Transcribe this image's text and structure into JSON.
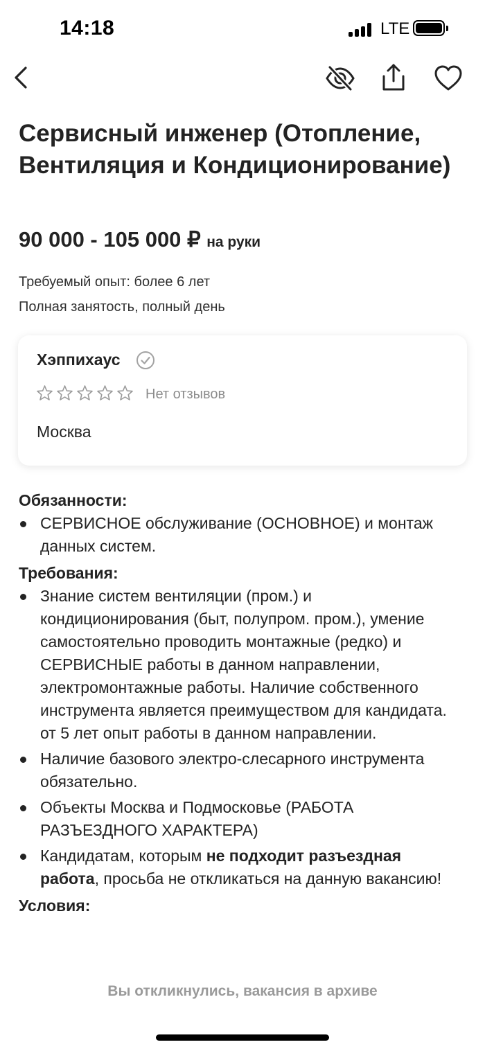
{
  "status_bar": {
    "time": "14:18",
    "network": "LTE",
    "icons": [
      "signal-icon",
      "battery-icon"
    ]
  },
  "nav": {
    "icons": [
      "chevron-left-icon",
      "eye-off-icon",
      "share-icon",
      "heart-icon"
    ]
  },
  "vacancy": {
    "title": "Сервисный инженер (Отопление, Вентиляция и Кондиционирование)",
    "salary": "90 000 - 105 000 ₽",
    "salary_suffix": "на руки",
    "experience": "Требуемый опыт: более 6 лет",
    "employment": "Полная занятость, полный день"
  },
  "employer": {
    "name": "Хэппихаус",
    "rating_stars": 0,
    "rating_max": 5,
    "reviews": "Нет отзывов",
    "city": "Москва",
    "icons": [
      "verified-icon",
      "star-outline-icon"
    ]
  },
  "description": {
    "duties_heading": "Обязанности:",
    "duties": [
      "СЕРВИСНОЕ обслуживание (ОСНОВНОЕ) и монтаж данных систем."
    ],
    "requirements_heading": "Требования:",
    "requirements": [
      "Знание систем вентиляции (пром.) и кондиционирования (быт, полупром. пром.), умение самостоятельно проводить монтажные (редко) и СЕРВИСНЫЕ работы в данном направлении, электромонтажные работы. Наличие собственного инструмента является преимуществом для кандидата. от 5 лет опыт работы в данном направлении.",
      "Наличие базового электро-слесарного инструмента обязательно.",
      "Объекты Москва и Подмосковье (РАБОТА РАЗЪЕЗДНОГО ХАРАКТЕРА)"
    ],
    "candidates_note": {
      "before": "Кандидатам, которым ",
      "bold": "не подходит разъездная работа",
      "after": ", просьба не откликаться на данную вакансию!"
    },
    "conditions_heading": "Условия:"
  },
  "bottom": {
    "archive_note": "Вы откликнулись, вакансия в архиве"
  },
  "colors": {
    "text": "#232323",
    "muted": "#8c8c8c",
    "archive_note": "#9a9a9a"
  }
}
